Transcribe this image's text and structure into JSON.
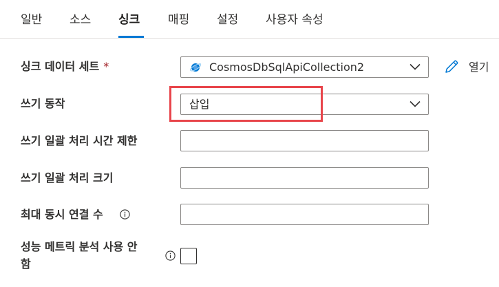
{
  "tabs": [
    {
      "label": "일반"
    },
    {
      "label": "소스"
    },
    {
      "label": "싱크",
      "active": true
    },
    {
      "label": "매핑"
    },
    {
      "label": "설정"
    },
    {
      "label": "사용자 속성"
    }
  ],
  "form": {
    "sink_dataset": {
      "label": "싱크 데이터 세트",
      "required_marker": "*",
      "value": "CosmosDbSqlApiCollection2",
      "icon": "cosmos-db-icon",
      "open_label": "열기"
    },
    "write_behavior": {
      "label": "쓰기 동작",
      "value": "삽입"
    },
    "write_batch_timeout": {
      "label": "쓰기 일괄 처리 시간 제한",
      "value": ""
    },
    "write_batch_size": {
      "label": "쓰기 일괄 처리 크기",
      "value": ""
    },
    "max_concurrent_connections": {
      "label": "최대 동시 연결 수",
      "value": ""
    },
    "disable_metrics": {
      "label_line1": "성능 메트릭 분석 사용 안",
      "label_line2": "함",
      "checked": false
    }
  },
  "colors": {
    "accent": "#0078d4",
    "highlight": "#e8454b",
    "required": "#a4262c"
  }
}
